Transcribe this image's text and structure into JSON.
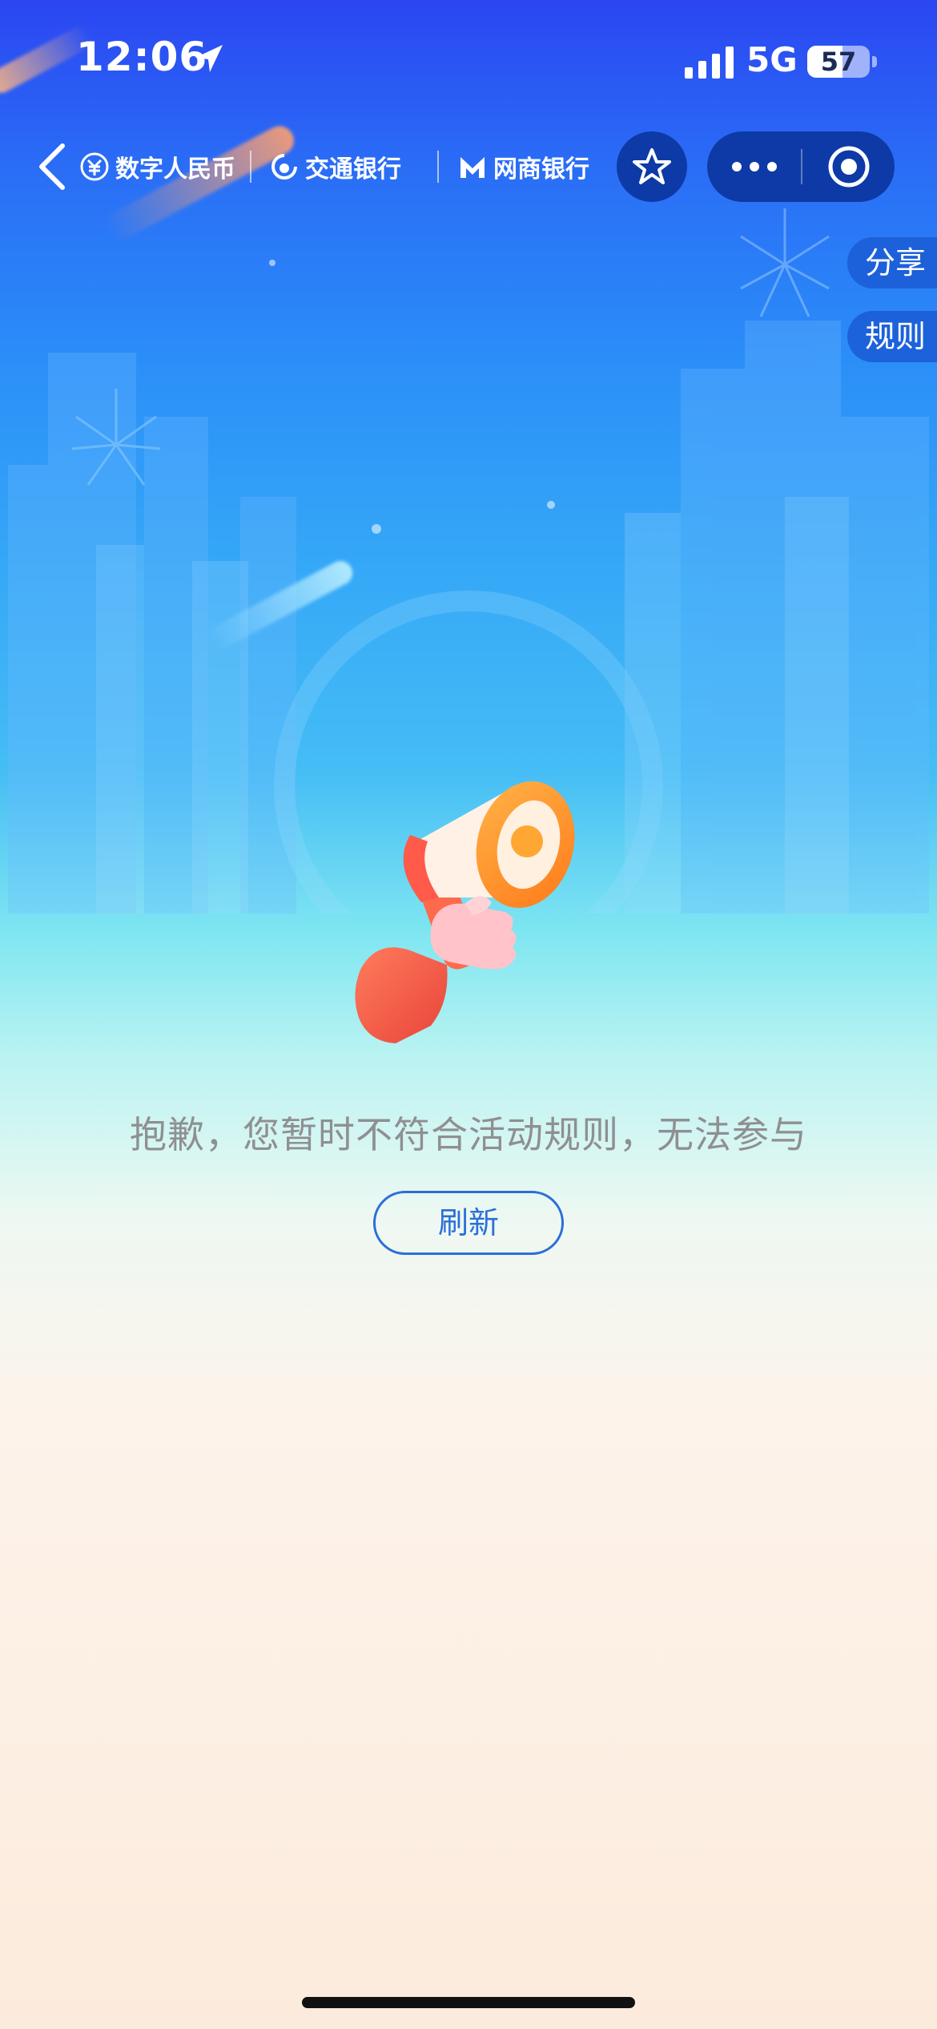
{
  "status_bar": {
    "time": "12:06",
    "network": "5G",
    "battery_level": "57",
    "battery_fraction": 0.57
  },
  "nav_bar": {
    "brands": [
      {
        "label": "数字人民币",
        "icon": "e-cny-logo-icon"
      },
      {
        "label": "交通银行",
        "icon": "bocom-logo-icon"
      },
      {
        "label": "网商银行",
        "icon": "mybank-logo-icon"
      }
    ],
    "icons": {
      "back": "chevron-left-icon",
      "favorite": "star-icon",
      "more": "more-dots-icon",
      "close": "target-icon"
    }
  },
  "side_tabs": {
    "share": "分享",
    "rules": "规则"
  },
  "main": {
    "illustration": "megaphone-icon",
    "message": "抱歉，您暂时不符合活动规则，无法参与",
    "refresh_label": "刷新"
  },
  "colors": {
    "accent": "#2a6fd9",
    "capsule_bg": "#0d3aa6",
    "message_text": "#8f8f92"
  }
}
